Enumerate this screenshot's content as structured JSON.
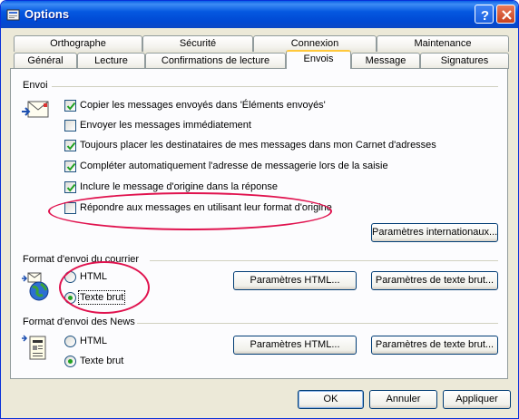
{
  "window": {
    "title": "Options"
  },
  "tabs_back": [
    "Orthographe",
    "Sécurité",
    "Connexion",
    "Maintenance"
  ],
  "tabs_front": [
    "Général",
    "Lecture",
    "Confirmations de lecture",
    "Envois",
    "Message",
    "Signatures"
  ],
  "active_tab": "Envois",
  "envoi": {
    "label": "Envoi",
    "options": [
      {
        "label": "Copier les messages envoyés dans 'Éléments envoyés'",
        "checked": true
      },
      {
        "label": "Envoyer les messages immédiatement",
        "checked": false
      },
      {
        "label": "Toujours placer les destinataires de mes messages dans mon Carnet d'adresses",
        "checked": true
      },
      {
        "label": "Compléter automatiquement l'adresse de messagerie lors de la saisie",
        "checked": true
      },
      {
        "label": "Inclure le message d'origine dans la réponse",
        "checked": true
      },
      {
        "label": "Répondre aux messages en utilisant leur format d'origine",
        "checked": false
      }
    ],
    "intl_button": "Paramètres internationaux..."
  },
  "mail_format": {
    "label": "Format d'envoi du courrier",
    "html_label": "HTML",
    "text_label": "Texte brut",
    "selected": "Texte brut",
    "html_settings": "Paramètres HTML...",
    "text_settings": "Paramètres de texte brut..."
  },
  "news_format": {
    "label": "Format d'envoi des News",
    "html_label": "HTML",
    "text_label": "Texte brut",
    "selected": "Texte brut",
    "html_settings": "Paramètres HTML...",
    "text_settings": "Paramètres de texte brut..."
  },
  "footer": {
    "ok": "OK",
    "cancel": "Annuler",
    "apply": "Appliquer"
  },
  "icons": {
    "title": "options-icon",
    "help": "help-icon",
    "close": "close-icon",
    "envoi": "outbox-envelope-icon",
    "mail": "globe-mail-icon",
    "news": "news-document-icon"
  },
  "colors": {
    "highlight_oval": "#e0124e",
    "radio_dot": "#21a121",
    "titlebar": "#0558e0"
  }
}
